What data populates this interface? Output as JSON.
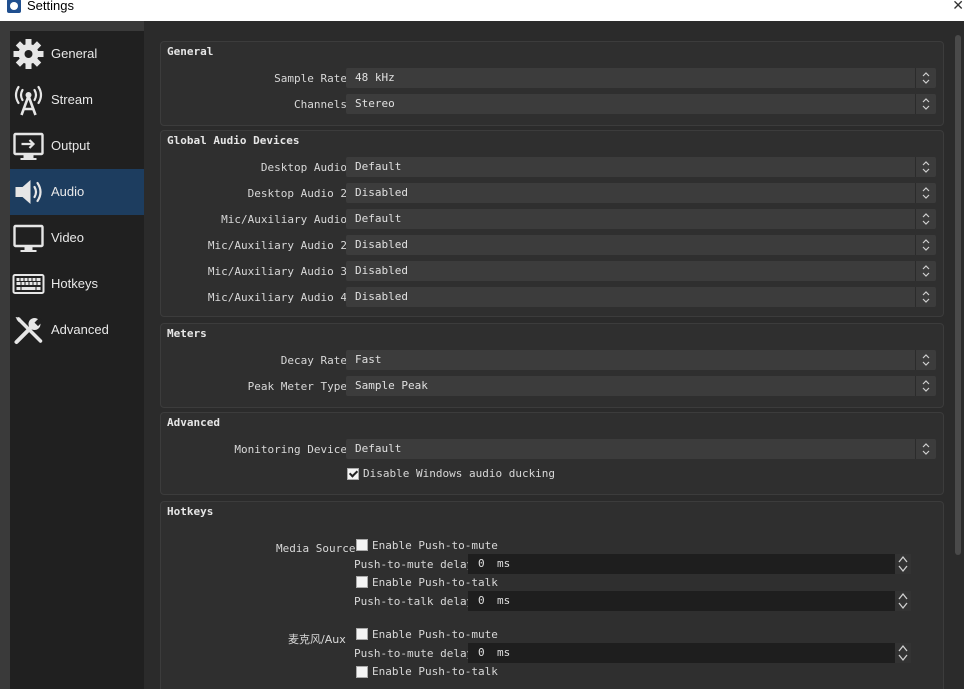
{
  "window": {
    "title": "Settings"
  },
  "sidebar": {
    "items": [
      {
        "label": "General",
        "icon": "gear-icon"
      },
      {
        "label": "Stream",
        "icon": "broadcast-tower-icon"
      },
      {
        "label": "Output",
        "icon": "output-monitor-icon"
      },
      {
        "label": "Audio",
        "icon": "speaker-icon"
      },
      {
        "label": "Video",
        "icon": "monitor-icon"
      },
      {
        "label": "Hotkeys",
        "icon": "keyboard-icon"
      },
      {
        "label": "Advanced",
        "icon": "wrench-screwdriver-icon"
      }
    ],
    "active": "Audio"
  },
  "general": {
    "title": "General",
    "sample_rate": {
      "label": "Sample Rate",
      "value": "48 kHz"
    },
    "channels": {
      "label": "Channels",
      "value": "Stereo"
    }
  },
  "global_audio": {
    "title": "Global Audio Devices",
    "rows": [
      {
        "label": "Desktop Audio",
        "value": "Default"
      },
      {
        "label": "Desktop Audio 2",
        "value": "Disabled"
      },
      {
        "label": "Mic/Auxiliary Audio",
        "value": "Default"
      },
      {
        "label": "Mic/Auxiliary Audio 2",
        "value": "Disabled"
      },
      {
        "label": "Mic/Auxiliary Audio 3",
        "value": "Disabled"
      },
      {
        "label": "Mic/Auxiliary Audio 4",
        "value": "Disabled"
      }
    ]
  },
  "meters": {
    "title": "Meters",
    "decay_rate": {
      "label": "Decay Rate",
      "value": "Fast"
    },
    "peak_meter": {
      "label": "Peak Meter Type",
      "value": "Sample Peak"
    }
  },
  "advanced": {
    "title": "Advanced",
    "monitoring": {
      "label": "Monitoring Device",
      "value": "Default"
    },
    "ducking": {
      "label": "Disable Windows audio ducking",
      "checked": true
    }
  },
  "hotkeys": {
    "title": "Hotkeys",
    "sources": [
      {
        "name": "Media Source",
        "push_to_mute_label": "Enable Push-to-mute",
        "push_to_mute_delay_label": "Push-to-mute delay",
        "push_to_mute_delay": "0",
        "push_to_talk_label": "Enable Push-to-talk",
        "push_to_talk_delay_label": "Push-to-talk delay",
        "push_to_talk_delay": "0",
        "unit": "ms"
      },
      {
        "name": "麦克风/Aux",
        "push_to_mute_label": "Enable Push-to-mute",
        "push_to_mute_delay_label": "Push-to-mute delay",
        "push_to_mute_delay": "0",
        "push_to_talk_label": "Enable Push-to-talk",
        "unit": "ms"
      }
    ]
  }
}
